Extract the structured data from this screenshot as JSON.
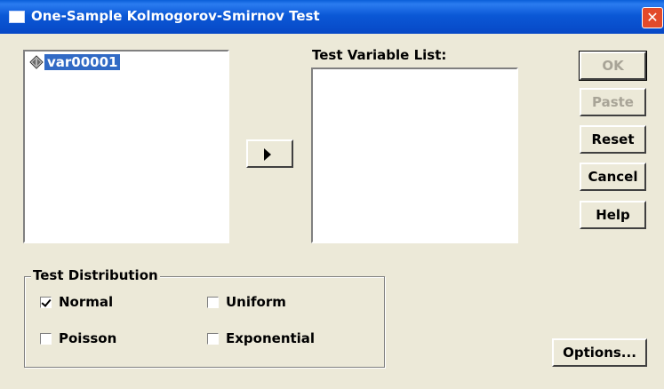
{
  "window": {
    "title": "One-Sample Kolmogorov-Smirnov Test",
    "close_icon": "close-icon"
  },
  "source_list": {
    "items": [
      {
        "label": "var00001",
        "icon": "scale-variable-icon"
      }
    ]
  },
  "target_list": {
    "label": "Test Variable List:",
    "items": []
  },
  "move_button": {
    "icon": "right-arrow-icon"
  },
  "buttons": {
    "ok": "OK",
    "paste": "Paste",
    "reset": "Reset",
    "cancel": "Cancel",
    "help": "Help",
    "options": "Options..."
  },
  "test_distribution": {
    "title": "Test Distribution",
    "normal": {
      "label": "Normal",
      "checked": true
    },
    "uniform": {
      "label": "Uniform",
      "checked": false
    },
    "poisson": {
      "label": "Poisson",
      "checked": false
    },
    "exponential": {
      "label": "Exponential",
      "checked": false
    }
  }
}
